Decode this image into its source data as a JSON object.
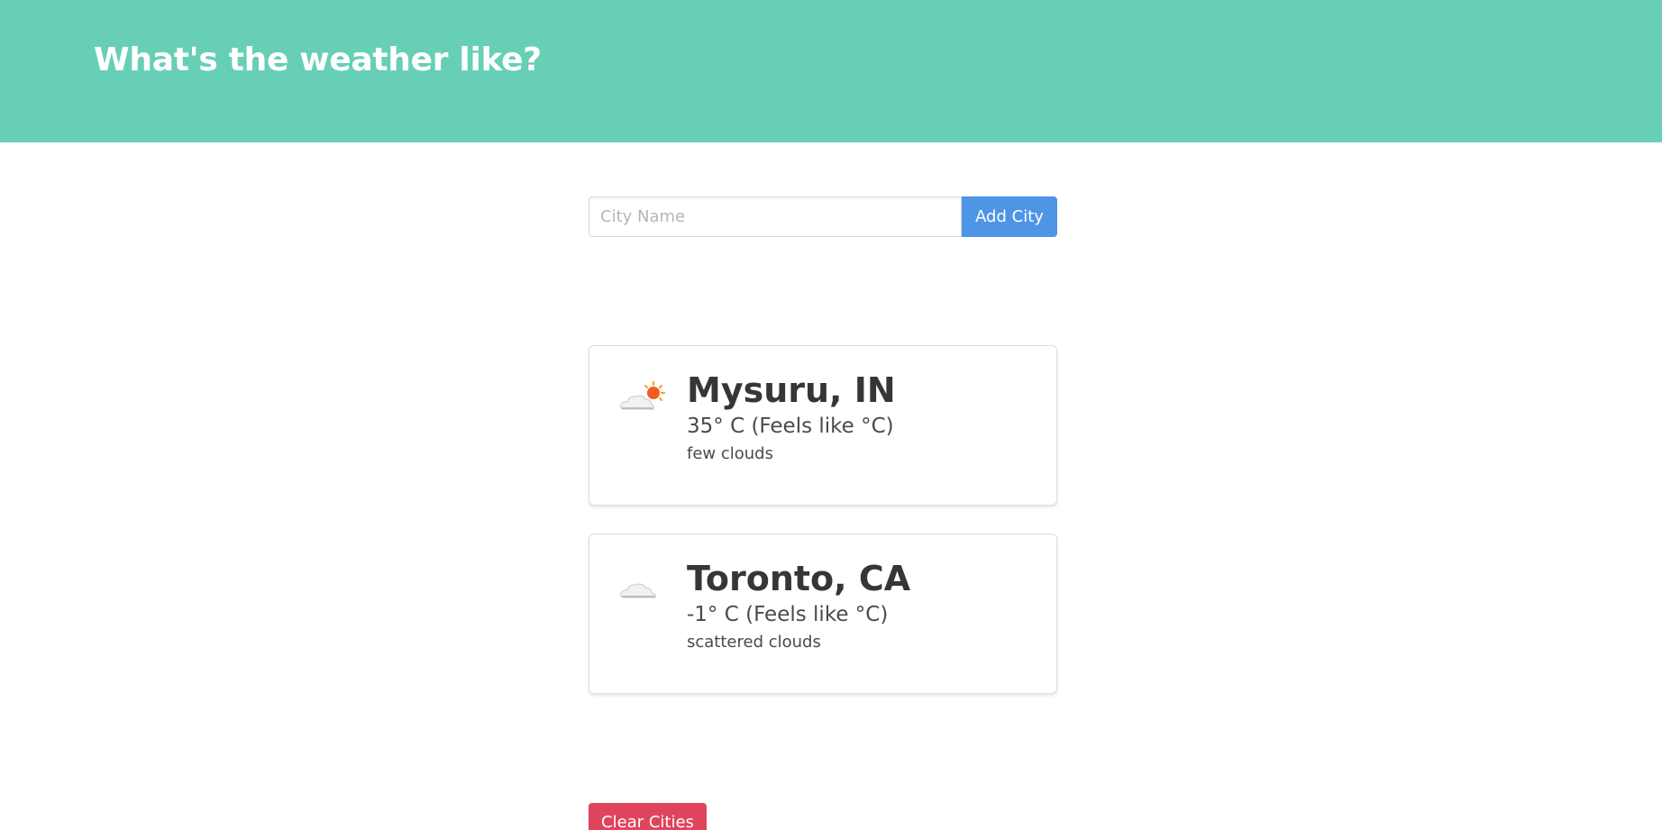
{
  "header": {
    "title": "What's the weather like?"
  },
  "search": {
    "placeholder": "City Name",
    "value": "",
    "add_button_label": "Add City"
  },
  "cities": [
    {
      "name": "Mysuru, IN",
      "temperature": "35° C (Feels like °C)",
      "description": "few clouds",
      "icon": "few-clouds-icon"
    },
    {
      "name": "Toronto, CA",
      "temperature": "-1° C (Feels like °C)",
      "description": "scattered clouds",
      "icon": "scattered-clouds-icon"
    }
  ],
  "footer": {
    "clear_button_label": "Clear Cities"
  },
  "colors": {
    "hero": "#67cfb5",
    "add_button": "#4e95e5",
    "clear_button": "#e0445c"
  }
}
